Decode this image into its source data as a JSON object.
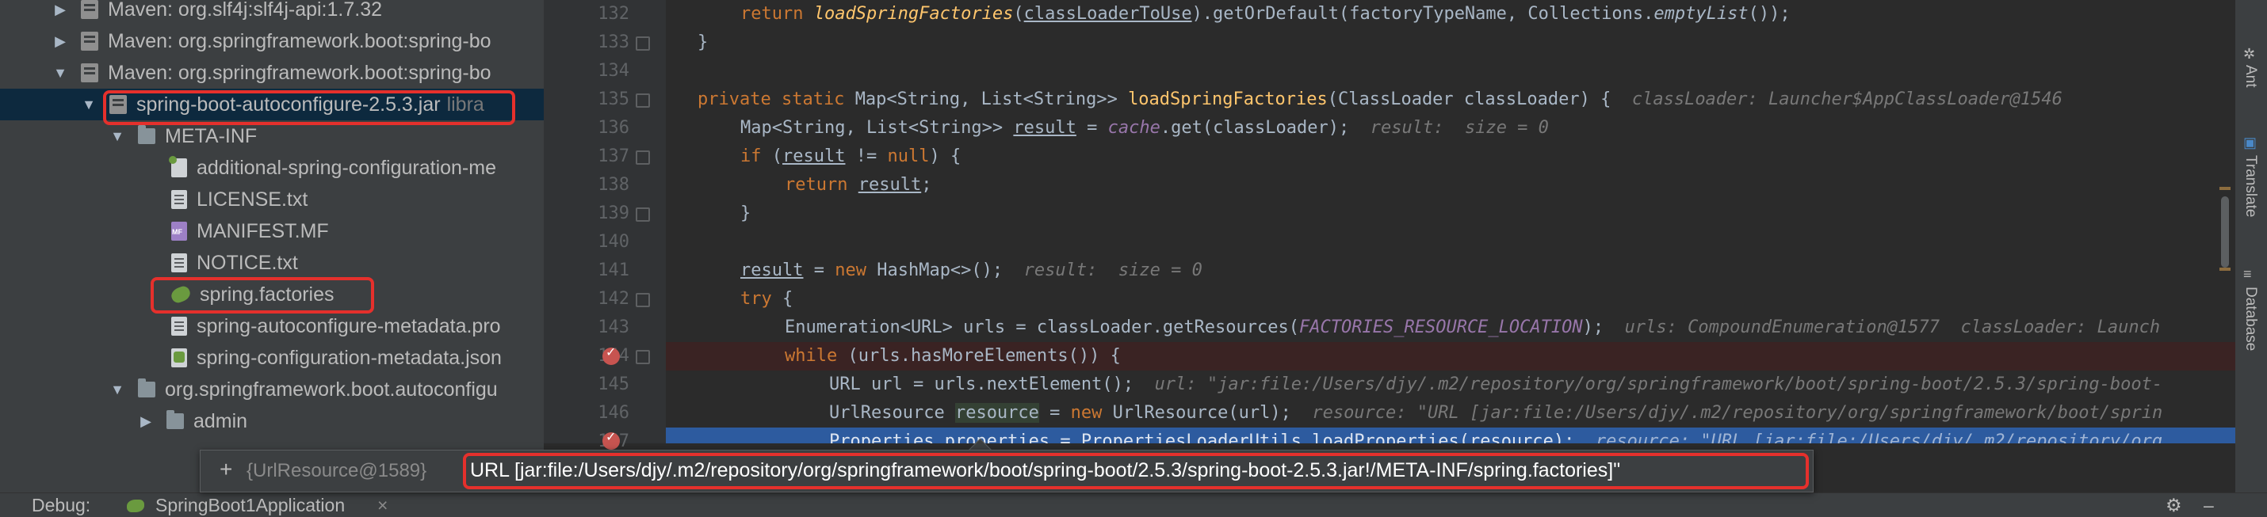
{
  "tree": {
    "items": [
      {
        "label": "Maven: org.slf4j:slf4j-api:1.7.32",
        "icon": "library-icon",
        "arrow": "▶"
      },
      {
        "label": "Maven: org.springframework.boot:spring-bo",
        "icon": "library-icon",
        "arrow": "▶"
      },
      {
        "label": "Maven: org.springframework.boot:spring-bo",
        "icon": "library-icon",
        "arrow": "▼"
      },
      {
        "label": "spring-boot-autoconfigure-2.5.3.jar",
        "suffix": "libra",
        "icon": "jar-icon",
        "arrow": "▼"
      },
      {
        "label": "META-INF",
        "icon": "folder-icon",
        "arrow": "▼"
      },
      {
        "label": "additional-spring-configuration-me",
        "icon": "config-file-icon",
        "arrow": ""
      },
      {
        "label": "LICENSE.txt",
        "icon": "text-file-icon",
        "arrow": ""
      },
      {
        "label": "MANIFEST.MF",
        "icon": "manifest-file-icon",
        "arrow": ""
      },
      {
        "label": "NOTICE.txt",
        "icon": "text-file-icon",
        "arrow": ""
      },
      {
        "label": "spring.factories",
        "icon": "spring-leaf-icon",
        "arrow": ""
      },
      {
        "label": "spring-autoconfigure-metadata.pro",
        "icon": "text-file-icon",
        "arrow": ""
      },
      {
        "label": "spring-configuration-metadata.json",
        "icon": "json-file-icon",
        "arrow": ""
      },
      {
        "label": "org.springframework.boot.autoconfigu",
        "icon": "package-icon",
        "arrow": "▼"
      },
      {
        "label": "admin",
        "icon": "package-icon",
        "arrow": "▶"
      }
    ]
  },
  "editor": {
    "line_numbers": [
      "132",
      "133",
      "134",
      "135",
      "136",
      "137",
      "138",
      "139",
      "140",
      "141",
      "142",
      "143",
      "144",
      "145",
      "146",
      "147"
    ],
    "lines": {
      "l132": {
        "kw": "return ",
        "fn": "loadSpringFactories",
        "p1": "(",
        "ul": "classLoaderToUse",
        "p2": ").getOrDefault(factoryTypeName, Collections.",
        "mth": "emptyList",
        "p3": "());"
      },
      "l133": {
        "t": "}"
      },
      "l135": {
        "kw": "private static ",
        "t1": "Map<String, List<String>> ",
        "fn": "loadSpringFactories",
        "t2": "(ClassLoader classLoader) {  ",
        "hint": "classLoader: Launcher$AppClassLoader@1546"
      },
      "l136": {
        "t1": "Map<String, List<String>> ",
        "ul": "result",
        "t2": " = ",
        "cst": "cache",
        "t3": ".get(classLoader);  ",
        "hint": "result:  size = 0"
      },
      "l137": {
        "kw": "if ",
        "t1": "(",
        "ul": "result",
        "t2": " != ",
        "kw2": "null",
        "t3": ") {"
      },
      "l138": {
        "kw": "return ",
        "ul": "result",
        "t": ";"
      },
      "l139": {
        "t": "}"
      },
      "l141": {
        "ul": "result",
        "t1": " = ",
        "kw": "new ",
        "t2": "HashMap<>();  ",
        "hint": "result:  size = 0"
      },
      "l142": {
        "kw": "try ",
        "t": "{"
      },
      "l143": {
        "t1": "Enumeration<URL> urls = classLoader.getResources(",
        "cst": "FACTORIES_RESOURCE_LOCATION",
        "t2": ");  ",
        "hint": "urls: CompoundEnumeration@1577  classLoader: Launch"
      },
      "l144": {
        "kw": "while ",
        "t": "(urls.hasMoreElements()) {"
      },
      "l145": {
        "t": "URL url = urls.nextElement();  ",
        "hint": "url: \"jar:file:/Users/djy/.m2/repository/org/springframework/boot/spring-boot/2.5.3/spring-boot-"
      },
      "l146": {
        "t1": "UrlResource ",
        "hl": "resource",
        "t2": " = ",
        "kw": "new ",
        "t3": "UrlResource(url);  ",
        "hint": "resource: \"URL [jar:file:/Users/djy/.m2/repository/org/springframework/boot/sprin"
      },
      "l147": {
        "t": "Properties properties = PropertiesLoaderUtils.loadProperties(resource);  ",
        "hint": "resource: \"URL [jar:file:/Users/djy/.m2/repository/org"
      }
    }
  },
  "tooltip": {
    "plus": "+",
    "object": "{UrlResource@1589}",
    "value": "URL [jar:file:/Users/djy/.m2/repository/org/springframework/boot/spring-boot/2.5.3/spring-boot-2.5.3.jar!/META-INF/spring.factories]\""
  },
  "right_strip": {
    "ant": "Ant",
    "translate": "Translate",
    "database": "Database"
  },
  "bottom_bar": {
    "debug_label": "Debug:",
    "config_name": "SpringBoot1Application",
    "close": "×"
  },
  "colors": {
    "annotation": "#e5302c",
    "execution_line": "#2d5b9f",
    "breakpoint": "#c75450"
  }
}
